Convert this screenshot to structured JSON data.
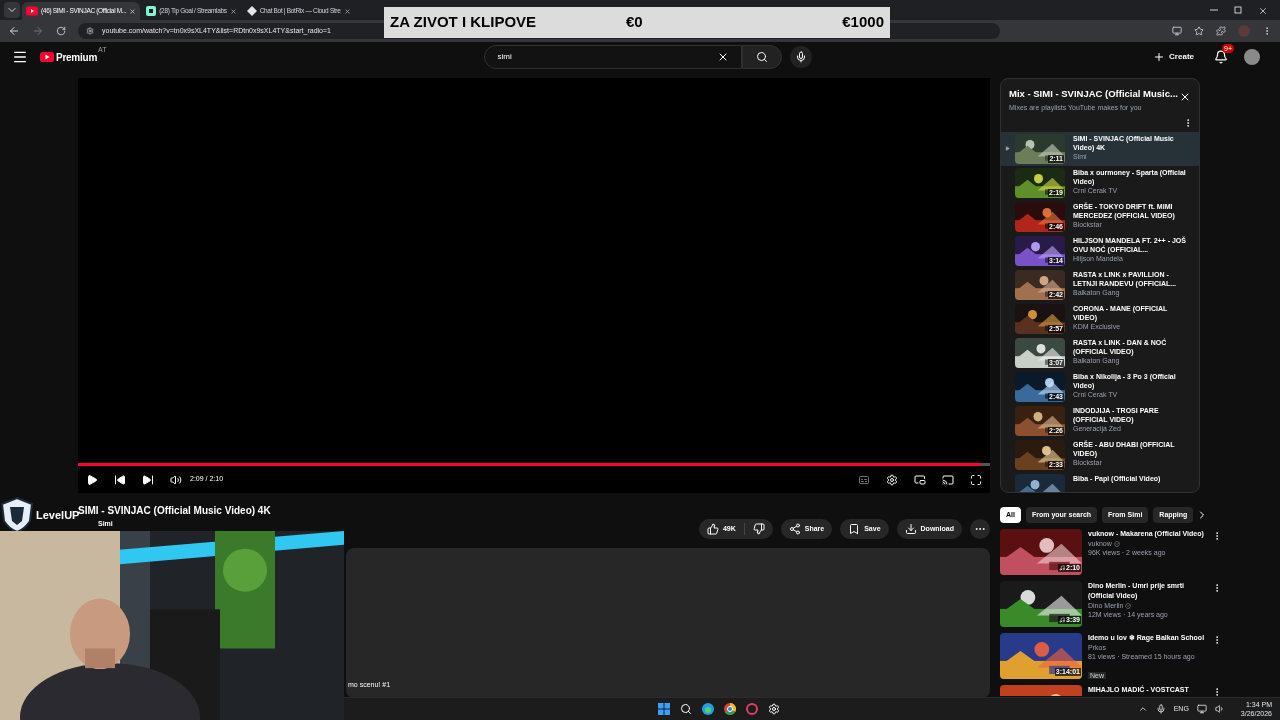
{
  "browser": {
    "tabs": [
      {
        "title": "(46) SIMI - SVINJAC (Official M...",
        "selected": true
      },
      {
        "title": "(28) Tip Goal / Streamlabs",
        "selected": false
      },
      {
        "title": "Chat Bot | BotRix — Cloud Stre",
        "selected": false
      }
    ],
    "url": "youtube.com/watch?v=tn0x9sXL4TY&list=RDtn0x9sXL4TY&start_radio=1"
  },
  "goal_overlay": {
    "title": "ZA ZIVOT I KLIPOVE",
    "current": "€0",
    "target": "€1000",
    "level": 0
  },
  "header": {
    "brand": "Premium",
    "region": "AT",
    "search_value": "simi",
    "create": "Create",
    "notifications": "9+"
  },
  "player": {
    "level": 0.99,
    "time": "2:09 / 2:10"
  },
  "video": {
    "title": "SIMI - SVINJAC (Official Music Video) 4K",
    "channel": "Simi",
    "likes": "49K",
    "actions": [
      "Share",
      "Save",
      "Download"
    ],
    "description_tail": "mo scenu! #1"
  },
  "stream_logo": "LevelUP",
  "playlist": {
    "title": "Mix - SIMI - SVINJAC (Official Music...",
    "subtitle": "Mixes are playlists YouTube makes for you",
    "items": [
      {
        "title": "SIMI - SVINJAC (Official Music Video) 4K",
        "channel": "Simi",
        "duration": "2:11",
        "selected": true
      },
      {
        "title": "Biba x ourmoney - Sparta (Official Video)",
        "channel": "Crni Cerak TV",
        "duration": "2:19",
        "selected": false
      },
      {
        "title": "GRŠE - TOKYO DRIFT ft. MIMI MERCEDEZ (OFFICIAL VIDEO)",
        "channel": "Blockstar",
        "duration": "2:46",
        "selected": false
      },
      {
        "title": "HILJSON MANDELA FT. 2++ - JOŠ OVU NOĆ (OFFICIAL...",
        "channel": "Hiljson Mandela",
        "duration": "3:14",
        "selected": false
      },
      {
        "title": "RASTA x LINK x PAVILLION - LETNJI RANDEVU (OFFICIAL...",
        "channel": "Balkaton Gang",
        "duration": "2:42",
        "selected": false
      },
      {
        "title": "CORONA - MANE (OFFICIAL VIDEO)",
        "channel": "KDM Exclusive",
        "duration": "2:57",
        "selected": false
      },
      {
        "title": "RASTA x LINK - DAN & NOĆ (OFFICIAL VIDEO)",
        "channel": "Balkaton Gang",
        "duration": "3:07",
        "selected": false
      },
      {
        "title": "Biba x Nikolija - 3 Po 3 (Official Video)",
        "channel": "Crni Cerak TV",
        "duration": "2:43",
        "selected": false
      },
      {
        "title": "INDODJIJA - TROSI PARE (OFFICIAL VIDEO)",
        "channel": "Generacija Zed",
        "duration": "2:26",
        "selected": false
      },
      {
        "title": "GRŠE - ABU DHABI (OFFICIAL VIDEO)",
        "channel": "Blockstar",
        "duration": "2:33",
        "selected": false
      },
      {
        "title": "Biba - Papi (Official Video)",
        "selected": false
      }
    ]
  },
  "chips": [
    {
      "label": "All",
      "selected": true
    },
    {
      "label": "From your search",
      "selected": false
    },
    {
      "label": "From Simi",
      "selected": false
    },
    {
      "label": "Rapping",
      "selected": false
    }
  ],
  "recommendations": [
    {
      "title": "vuknow - Makarena (Official Video)",
      "channel": "vuknow",
      "verified": true,
      "meta": "96K views · 2 weeks ago",
      "duration": "2:10",
      "music": true
    },
    {
      "title": "Dino Merlin - Umri prije smrti (Official Video)",
      "channel": "Dino Merlin",
      "verified": true,
      "meta": "12M views · 14 years ago",
      "duration": "3:39",
      "music": true
    },
    {
      "title": "Idemo u lov ❄ Rage Balkan School",
      "channel": "Prkos",
      "verified": false,
      "meta": "81 views · Streamed 15 hours ago",
      "duration": "3:14:01",
      "music": false,
      "badge": "New"
    },
    {
      "title": "MIHAJLO MADIĆ - VOSTCAST",
      "verified": false,
      "music": false
    }
  ],
  "taskbar": {
    "language": "ENG",
    "time": "1:34 PM",
    "date": "3/26/2026"
  }
}
